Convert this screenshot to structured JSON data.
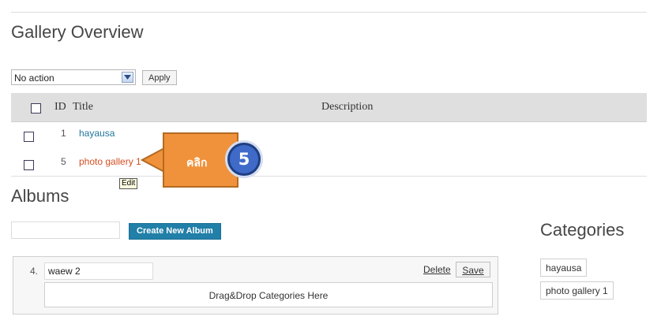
{
  "gallery": {
    "title": "Gallery Overview",
    "bulk_action": "No action",
    "apply_label": "Apply",
    "columns": {
      "id": "ID",
      "title": "Title",
      "description": "Description"
    },
    "rows": [
      {
        "id": "1",
        "title": "hayausa",
        "title_color": "#21759b"
      },
      {
        "id": "5",
        "title": "photo gallery 1",
        "title_color": "#d54e21"
      }
    ],
    "tooltip": "Edit"
  },
  "callout": {
    "text": "คลิก",
    "step": "5",
    "color": "#f0923b"
  },
  "albums": {
    "heading": "Albums",
    "create_label": "Create New Album",
    "new_album_value": "",
    "items": [
      {
        "number": "4.",
        "name": "waew 2",
        "delete_label": "Delete",
        "save_label": "Save",
        "drop_label": "Drag&Drop Categories Here"
      }
    ]
  },
  "categories": {
    "heading": "Categories",
    "items": [
      "hayausa",
      "photo gallery 1"
    ]
  }
}
